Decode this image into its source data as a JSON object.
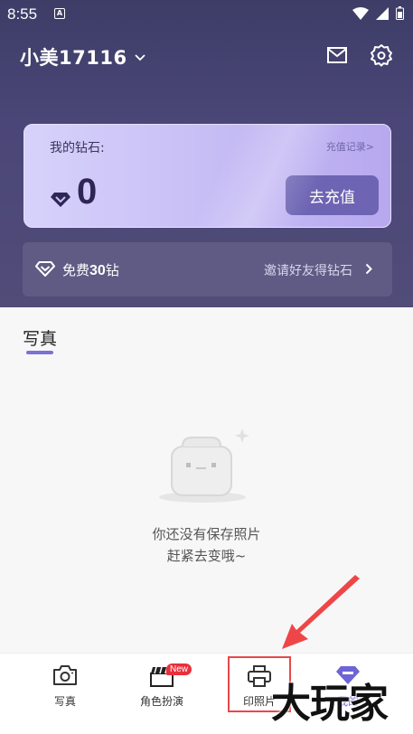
{
  "status_bar": {
    "time": "8:55",
    "app_icon": "A"
  },
  "header": {
    "username": "小美17116"
  },
  "diamond_card": {
    "label": "我的钻石:",
    "history_link": "充值记录>",
    "balance": "0",
    "recharge_button": "去充值"
  },
  "invite_banner": {
    "prefix": "免费",
    "amount": "30",
    "suffix": "钻",
    "link_text": "邀请好友得钻石"
  },
  "section": {
    "title": "写真"
  },
  "empty_state": {
    "line1": "你还没有保存照片",
    "line2": "赶紧去变哦~"
  },
  "tabs": [
    {
      "label": "写真",
      "icon": "camera-icon"
    },
    {
      "label": "角色扮演",
      "icon": "clapperboard-icon",
      "badge": "New"
    },
    {
      "label": "印照片",
      "icon": "printer-icon"
    },
    {
      "label": "我的",
      "icon": "profile-diamond-icon"
    }
  ],
  "watermark": "大玩家",
  "colors": {
    "accent": "#7b73d1",
    "hero_bg": "#45426f",
    "highlight": "#e9474a"
  }
}
